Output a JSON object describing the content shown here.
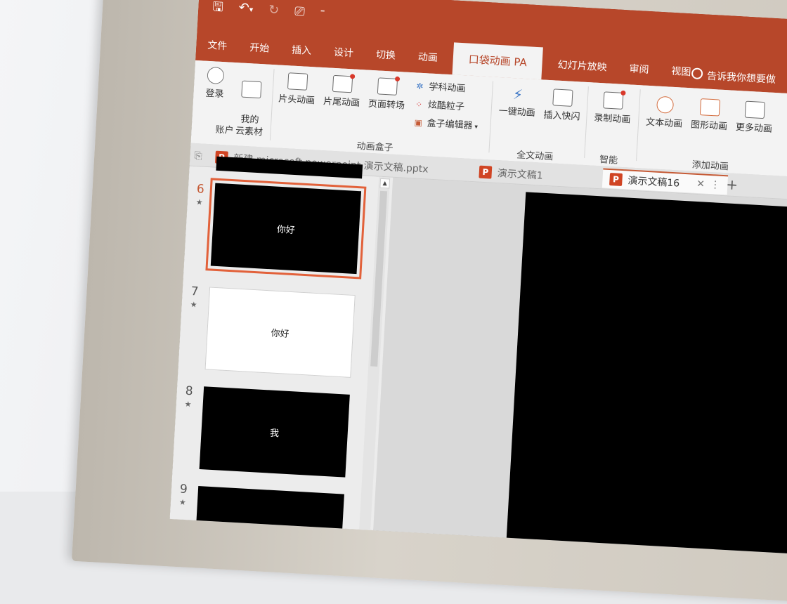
{
  "qat": {
    "save_icon": "save-icon",
    "undo_icon": "undo-icon",
    "redo_icon": "redo-icon",
    "present_icon": "present-icon",
    "more_icon": "chevron-down-icon",
    "save_glyph": "🖫",
    "undo_glyph": "↶",
    "undo_dd": "▾",
    "redo_glyph": "↻",
    "present_glyph": "⎚",
    "more_glyph": "⁼"
  },
  "tabs": [
    "文件",
    "开始",
    "插入",
    "设计",
    "切换",
    "动画",
    "口袋动画 PA",
    "幻灯片放映",
    "审阅",
    "视图"
  ],
  "tell_me": "告诉我你想要做",
  "ribbon": {
    "account": {
      "login": "登录",
      "cloud": "我的\n云素材",
      "group": "账户"
    },
    "box": {
      "opening": "片头动画",
      "ending": "片尾动画",
      "transition": "页面转场",
      "subject": "学科动画",
      "particles": "炫酷粒子",
      "editor": "盒子编辑器",
      "editor_arrow": "▾",
      "group": "动画盒子"
    },
    "full": {
      "onekey": "一键动画",
      "flash": "插入快闪",
      "group": "全文动画"
    },
    "smart": {
      "record": "录制动画",
      "group": "智能"
    },
    "add": {
      "text": "文本动画",
      "shape": "图形动画",
      "more": "更多动画",
      "group": "添加动画"
    }
  },
  "files": {
    "first": "新建 microsoft powerpoint 演示文稿.pptx",
    "second": "演示文稿1",
    "active": "演示文稿16",
    "close": "✕",
    "menu": "⋮",
    "add": "+",
    "ppt_letter": "P"
  },
  "slides": [
    {
      "num": "6",
      "text": "你好",
      "theme": "dark",
      "selected": true
    },
    {
      "num": "7",
      "text": "你好",
      "theme": "light",
      "selected": false
    },
    {
      "num": "8",
      "text": "我",
      "theme": "dark",
      "selected": false
    },
    {
      "num": "9",
      "text": "",
      "theme": "dark",
      "selected": false
    }
  ],
  "star": "★",
  "scroll_up": "▲",
  "colors": {
    "brand": "#b7472a",
    "selection": "#e2613a"
  }
}
